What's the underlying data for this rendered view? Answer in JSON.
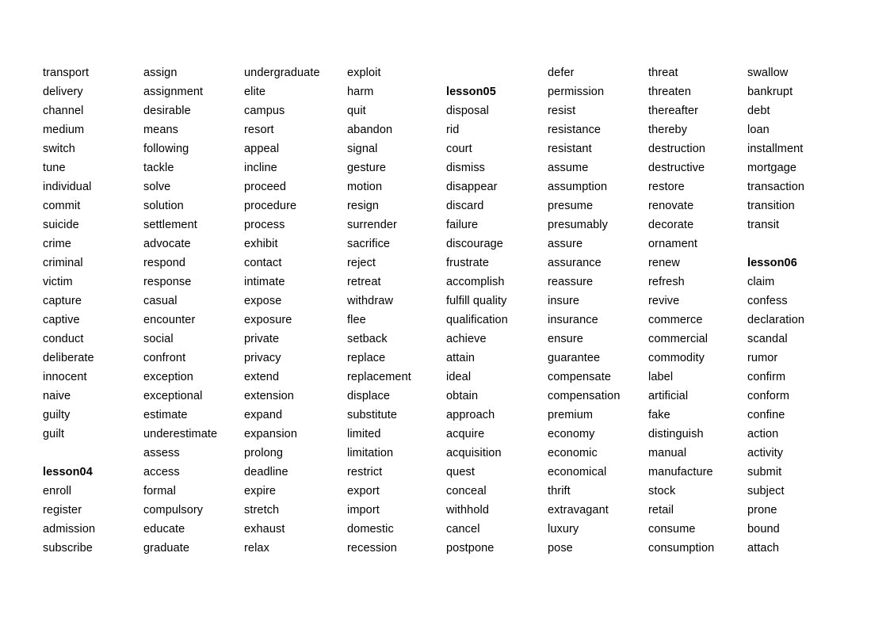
{
  "page": {
    "kind": "vocabulary-word-list",
    "row_count": 26,
    "column_count": 8,
    "text_color": "#000000",
    "background_color": "#ffffff"
  },
  "columns": [
    {
      "index": 1,
      "name": "column-1",
      "words": [
        "transport",
        "delivery",
        "channel",
        "medium",
        "switch",
        "tune",
        "individual",
        "commit",
        "suicide",
        "crime",
        "criminal",
        "victim",
        "capture",
        "captive",
        "conduct",
        "deliberate",
        "innocent",
        "naive",
        "guilty",
        "guilt",
        "",
        "lesson04",
        "enroll",
        "register",
        "admission",
        "subscribe"
      ],
      "headings": [
        "lesson04"
      ]
    },
    {
      "index": 2,
      "name": "column-2",
      "words": [
        "assign",
        "assignment",
        "desirable",
        "means",
        "following",
        "tackle",
        "solve",
        "solution",
        "settlement",
        "advocate",
        "respond",
        "response",
        "casual",
        "encounter",
        "social",
        "confront",
        "exception",
        "exceptional",
        "estimate",
        "underestimate",
        "assess",
        "access",
        "formal",
        "compulsory",
        "educate",
        "graduate"
      ],
      "headings": []
    },
    {
      "index": 3,
      "name": "column-3",
      "words": [
        "undergraduate",
        "elite",
        "campus",
        "resort",
        "appeal",
        "incline",
        "proceed",
        "procedure",
        "process",
        "exhibit",
        "contact",
        "intimate",
        "expose",
        "exposure",
        "private",
        "privacy",
        "extend",
        "extension",
        "expand",
        "expansion",
        "prolong",
        "deadline",
        "expire",
        "stretch",
        "exhaust",
        "relax"
      ],
      "headings": []
    },
    {
      "index": 4,
      "name": "column-4",
      "words": [
        "exploit",
        "harm",
        "quit",
        "abandon",
        "signal",
        "gesture",
        "motion",
        "resign",
        "surrender",
        "sacrifice",
        "reject",
        "retreat",
        "withdraw",
        "flee",
        "setback",
        "replace",
        "replacement",
        "displace",
        "substitute",
        "limited",
        "limitation",
        "restrict",
        "export",
        "import",
        "domestic",
        "recession"
      ],
      "headings": []
    },
    {
      "index": 5,
      "name": "column-5",
      "words": [
        "",
        "lesson05",
        "disposal",
        "rid",
        "court",
        "dismiss",
        "disappear",
        "discard",
        "failure",
        "discourage",
        "frustrate",
        "accomplish",
        "fulfill quality",
        "qualification",
        "achieve",
        "attain",
        "ideal",
        "obtain",
        "approach",
        "acquire",
        "acquisition",
        "quest",
        "conceal",
        "withhold",
        "cancel",
        "postpone"
      ],
      "headings": [
        "lesson05"
      ]
    },
    {
      "index": 6,
      "name": "column-6",
      "words": [
        "defer",
        "permission",
        "resist",
        "resistance",
        "resistant",
        "assume",
        "assumption",
        "presume",
        "presumably",
        "assure",
        "assurance",
        "reassure",
        "insure",
        "insurance",
        "ensure",
        "guarantee",
        "compensate",
        "compensation",
        "premium",
        "economy",
        "economic",
        "economical",
        "thrift",
        "extravagant",
        "luxury",
        "pose"
      ],
      "headings": []
    },
    {
      "index": 7,
      "name": "column-7",
      "words": [
        "threat",
        "threaten",
        "thereafter",
        "thereby",
        "destruction",
        "destructive",
        "restore",
        "renovate",
        "decorate",
        "ornament",
        "renew",
        "refresh",
        "revive",
        "commerce",
        "commercial",
        "commodity",
        "label",
        "artificial",
        "fake",
        "distinguish",
        "manual",
        "manufacture",
        "stock",
        "retail",
        "consume",
        "consumption"
      ],
      "headings": []
    },
    {
      "index": 8,
      "name": "column-8",
      "words": [
        "swallow",
        "bankrupt",
        "debt",
        "loan",
        "installment",
        "mortgage",
        "transaction",
        "transition",
        "transit",
        "",
        "lesson06",
        "claim",
        "confess",
        "declaration",
        "scandal",
        "rumor",
        "confirm",
        "conform",
        "confine",
        "action",
        "activity",
        "submit",
        "subject",
        "prone",
        "bound",
        "attach"
      ],
      "headings": [
        "lesson06"
      ]
    }
  ]
}
